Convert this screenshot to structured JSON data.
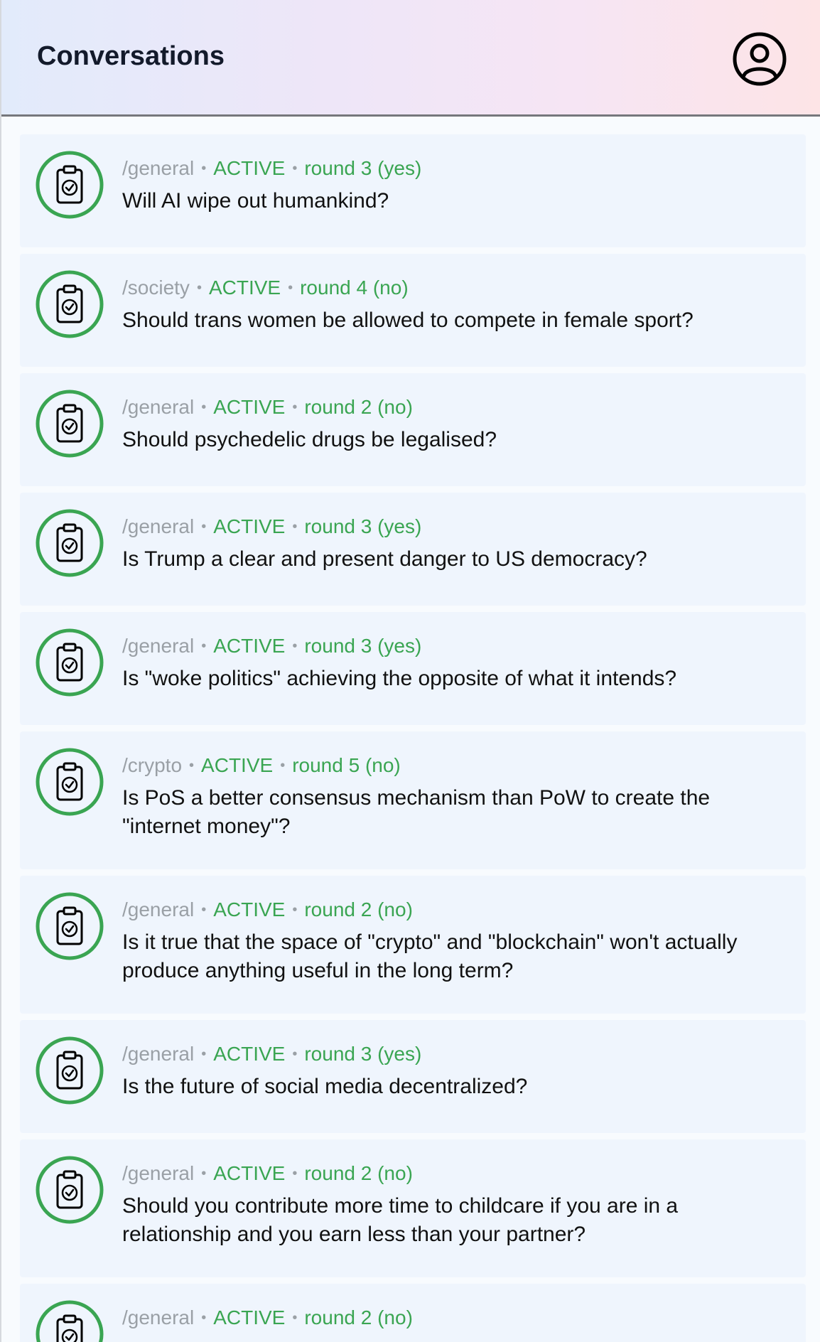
{
  "header": {
    "title": "Conversations",
    "profile_icon": "user-circle-icon"
  },
  "colors": {
    "accent_green": "#3aa552",
    "muted_gray": "#9aa0a6",
    "card_background": "#eff5fd"
  },
  "conversations": [
    {
      "category": "/general",
      "status": "ACTIVE",
      "round": "round 3 (yes)",
      "title": "Will AI wipe out humankind?",
      "icon": "clipboard-check-icon"
    },
    {
      "category": "/society",
      "status": "ACTIVE",
      "round": "round 4 (no)",
      "title": "Should trans women be allowed to compete in female sport?",
      "icon": "clipboard-check-icon"
    },
    {
      "category": "/general",
      "status": "ACTIVE",
      "round": "round 2 (no)",
      "title": "Should psychedelic drugs be legalised?",
      "icon": "clipboard-check-icon"
    },
    {
      "category": "/general",
      "status": "ACTIVE",
      "round": "round 3 (yes)",
      "title": "Is Trump a clear and present danger to US democracy?",
      "icon": "clipboard-check-icon"
    },
    {
      "category": "/general",
      "status": "ACTIVE",
      "round": "round 3 (yes)",
      "title": "Is \"woke politics\" achieving the opposite of what it intends?",
      "icon": "clipboard-check-icon"
    },
    {
      "category": "/crypto",
      "status": "ACTIVE",
      "round": "round 5 (no)",
      "title": "Is PoS a better consensus mechanism than PoW to create the \"internet money\"?",
      "icon": "clipboard-check-icon"
    },
    {
      "category": "/general",
      "status": "ACTIVE",
      "round": "round 2 (no)",
      "title": "Is it true that the space of \"crypto\" and \"blockchain\" won't actually produce anything useful in the long term?",
      "icon": "clipboard-check-icon"
    },
    {
      "category": "/general",
      "status": "ACTIVE",
      "round": "round 3 (yes)",
      "title": "Is the future of social media decentralized?",
      "icon": "clipboard-check-icon"
    },
    {
      "category": "/general",
      "status": "ACTIVE",
      "round": "round 2 (no)",
      "title": "Should you contribute more time to childcare if you are in a relationship and you earn less than your partner?",
      "icon": "clipboard-check-icon"
    },
    {
      "category": "/general",
      "status": "ACTIVE",
      "round": "round 2 (no)",
      "title": "",
      "icon": "clipboard-check-icon"
    }
  ]
}
